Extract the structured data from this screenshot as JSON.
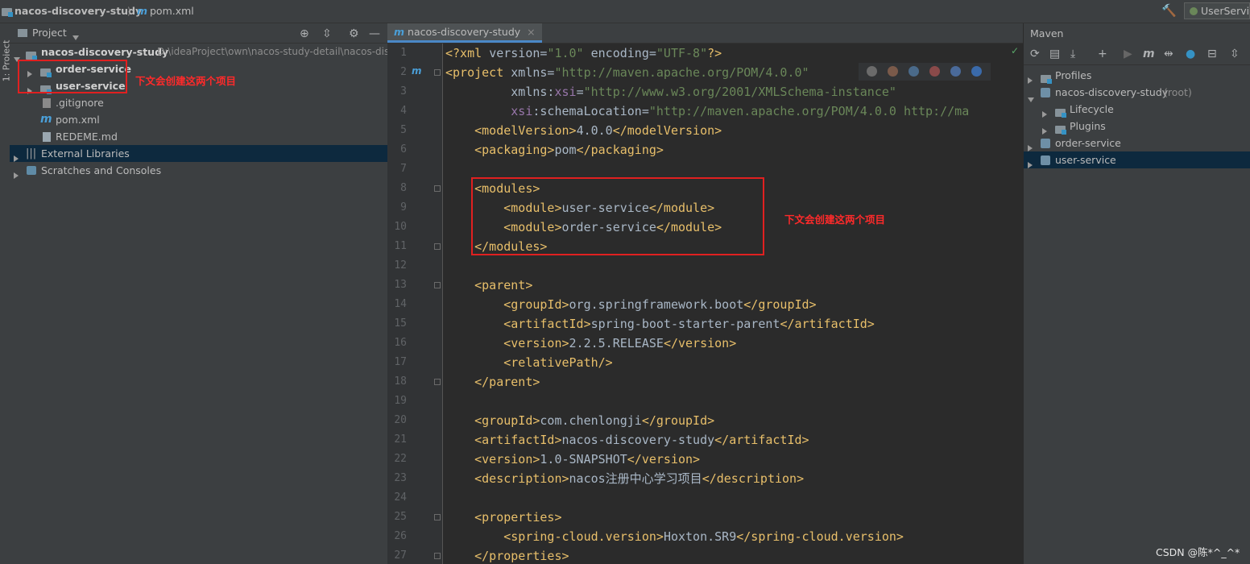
{
  "breadcrumb": {
    "project": "nacos-discovery-study",
    "file": "pom.xml",
    "run_config": "UserServi"
  },
  "left_stripe": {
    "label": "1: Project"
  },
  "project_panel": {
    "title": "Project",
    "root": {
      "name": "nacos-discovery-study",
      "path": "D:\\ideaProject\\own\\nacos-study-detail\\nacos-dis"
    },
    "items": [
      {
        "label": "order-service"
      },
      {
        "label": "user-service"
      },
      {
        "label": ".gitignore"
      },
      {
        "label": "pom.xml"
      },
      {
        "label": "REDEME.md"
      },
      {
        "label": "External Libraries"
      },
      {
        "label": "Scratches and Consoles"
      }
    ],
    "annotation": "下文会创建这两个项目"
  },
  "editor": {
    "tab_label": "nacos-discovery-study",
    "annotation": "下文会创建这两个项目"
  },
  "maven_panel": {
    "title": "Maven",
    "items": [
      {
        "label": "Profiles"
      },
      {
        "label": "nacos-discovery-study",
        "suffix": "(root)"
      },
      {
        "label": "Lifecycle"
      },
      {
        "label": "Plugins"
      },
      {
        "label": "order-service"
      },
      {
        "label": "user-service"
      }
    ]
  },
  "watermark": "CSDN @陈*^_^*",
  "colors": {
    "accent": "#4a88c7",
    "annotation": "#e02020",
    "selection": "#0d293e"
  }
}
